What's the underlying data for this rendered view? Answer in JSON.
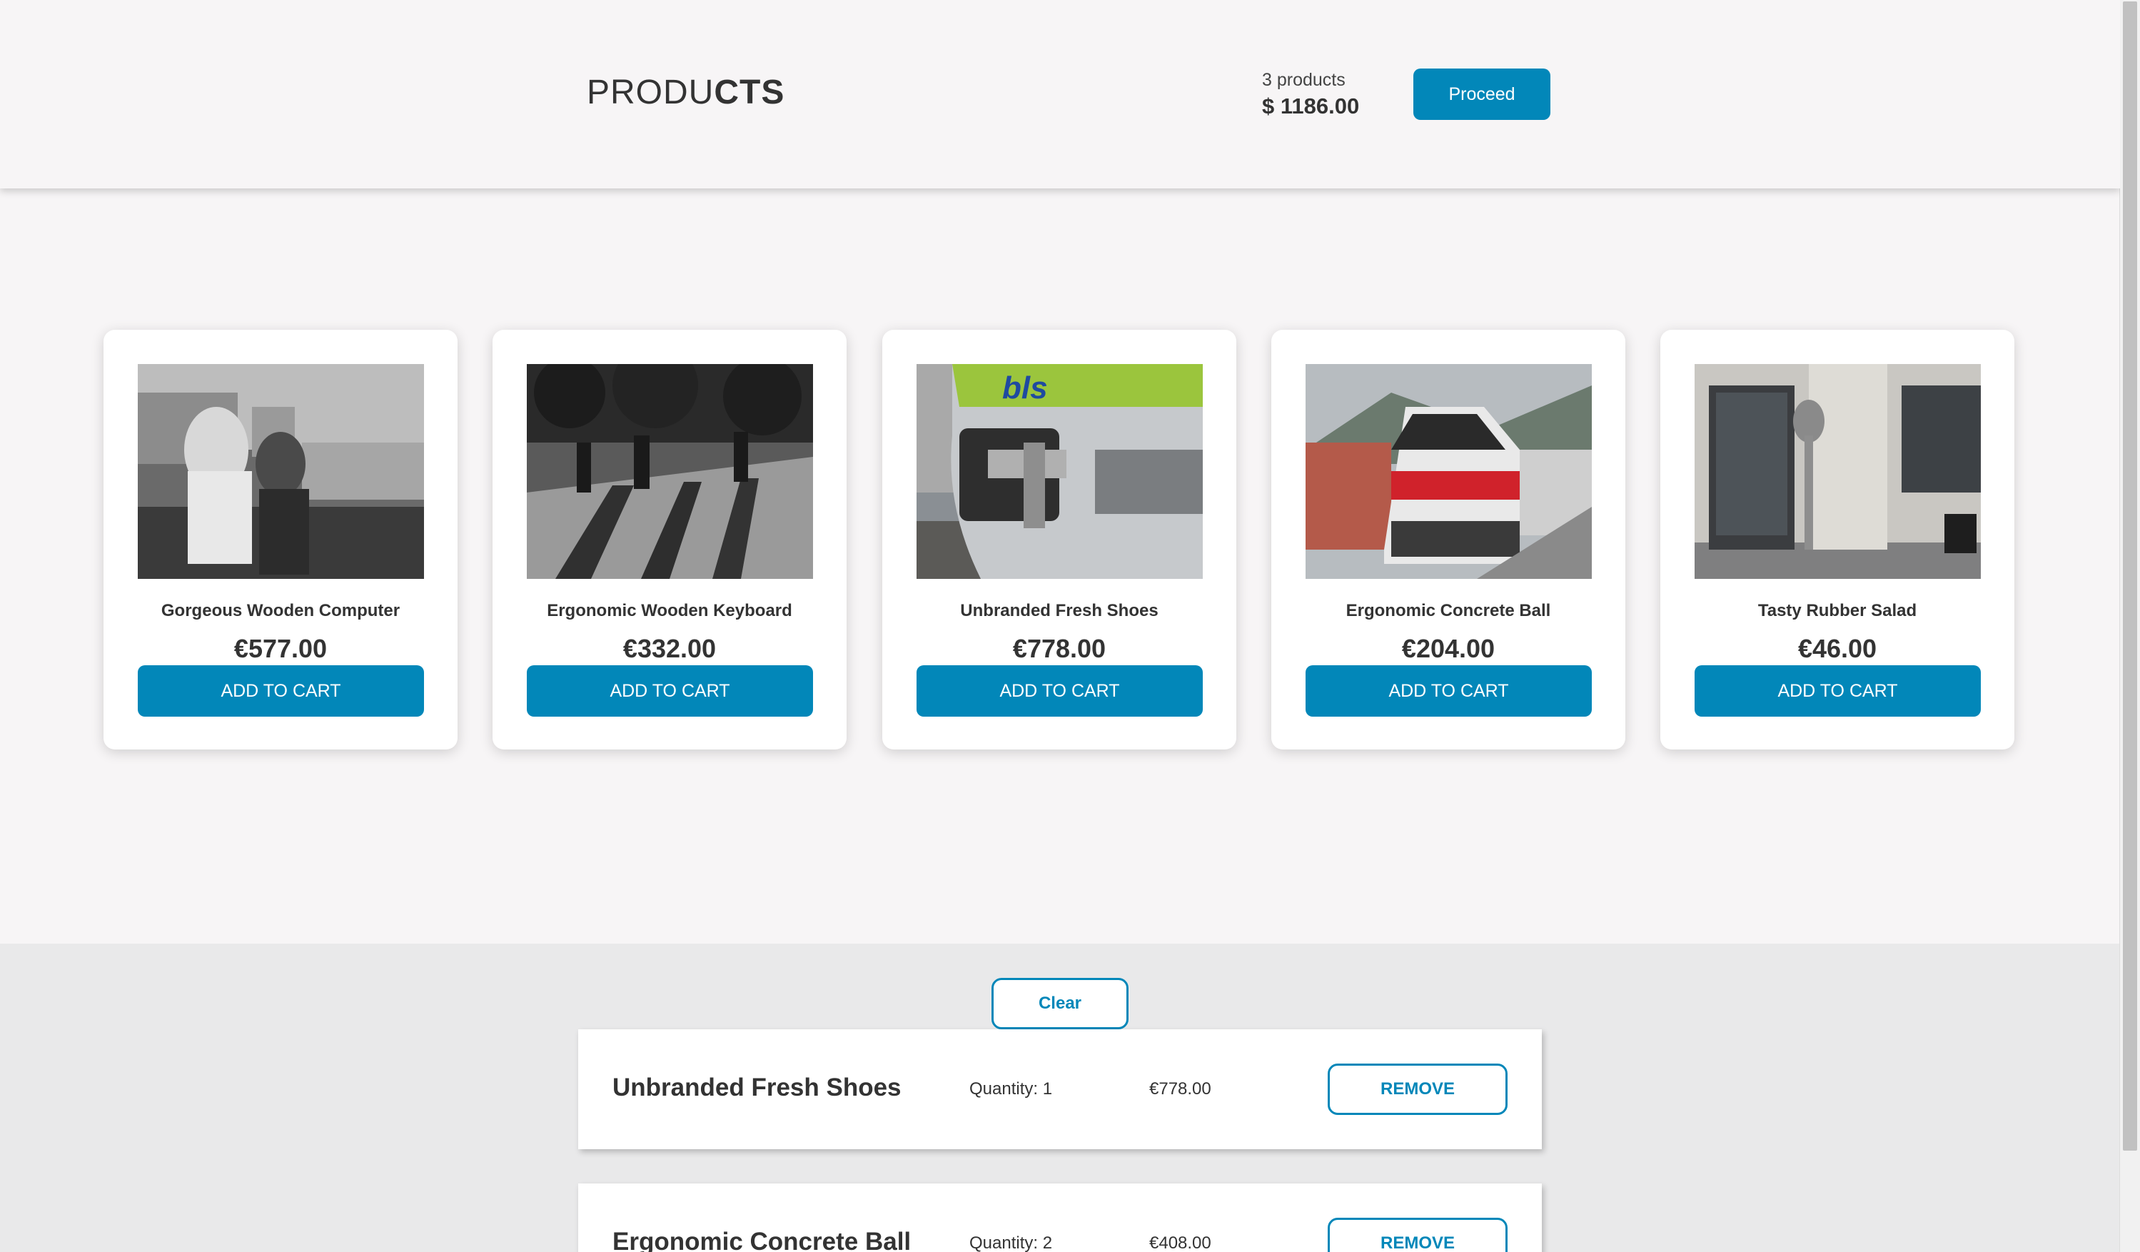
{
  "header": {
    "brand_light": "PRODU",
    "brand_bold": "CTS",
    "product_count": "3 products",
    "total": "$ 1186.00",
    "proceed_label": "Proceed"
  },
  "products": [
    {
      "name": "Gorgeous Wooden Computer",
      "price": "€577.00",
      "add_label": "ADD TO CART",
      "image": "black-and-white photo of girls on a terrace"
    },
    {
      "name": "Ergonomic Wooden Keyboard",
      "price": "€332.00",
      "add_label": "ADD TO CART",
      "image": "black-and-white photo of people with long shadows"
    },
    {
      "name": "Unbranded Fresh Shoes",
      "price": "€778.00",
      "add_label": "ADD TO CART",
      "image": "bls train coupling close-up"
    },
    {
      "name": "Ergonomic Concrete Ball",
      "price": "€204.00",
      "add_label": "ADD TO CART",
      "image": "red and white train at platform"
    },
    {
      "name": "Tasty Rubber Salad",
      "price": "€46.00",
      "add_label": "ADD TO CART",
      "image": "grey station building entrance"
    }
  ],
  "cart": {
    "clear_label": "Clear",
    "items": [
      {
        "name": "Unbranded Fresh Shoes",
        "quantity": "Quantity: 1",
        "price": "€778.00",
        "remove_label": "REMOVE"
      },
      {
        "name": "Ergonomic Concrete Ball",
        "quantity": "Quantity: 2",
        "price": "€408.00",
        "remove_label": "REMOVE"
      }
    ]
  },
  "colors": {
    "accent": "#0287b9",
    "background": "#f7f5f6",
    "cart_background": "#e9e9ea"
  }
}
